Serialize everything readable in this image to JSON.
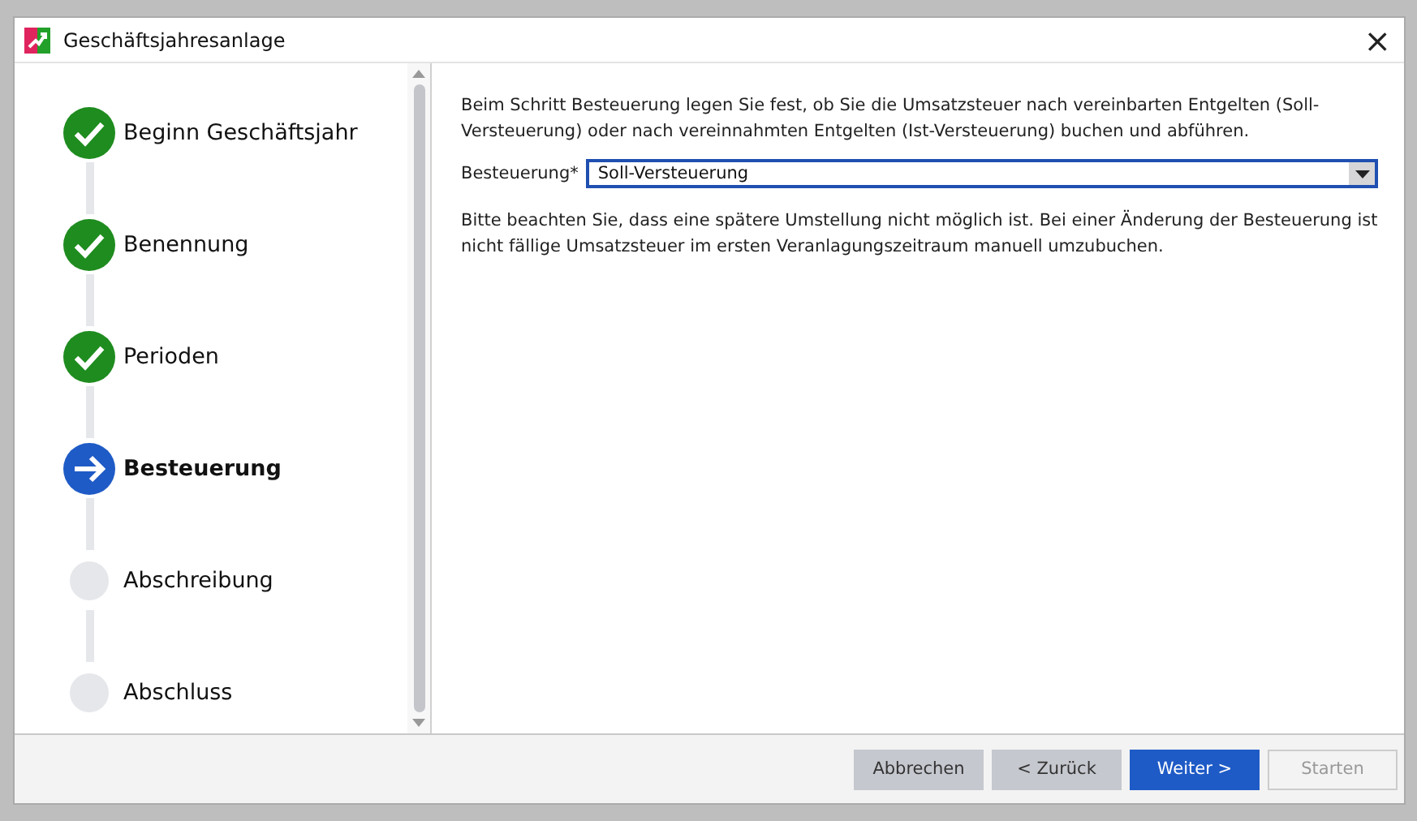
{
  "window": {
    "title": "Geschäftsjahresanlage",
    "close": "×"
  },
  "steps": [
    {
      "label": "Beginn Geschäftsjahr",
      "kind": "done",
      "selected": false
    },
    {
      "label": "Benennung",
      "kind": "done",
      "selected": false
    },
    {
      "label": "Perioden",
      "kind": "done",
      "selected": false
    },
    {
      "label": "Besteuerung",
      "kind": "current",
      "selected": true
    },
    {
      "label": "Abschreibung",
      "kind": "pending",
      "selected": false
    },
    {
      "label": "Abschluss",
      "kind": "pending",
      "selected": false
    }
  ],
  "intro": "Beim Schritt Besteuerung legen Sie fest, ob Sie die Umsatzsteuer nach vereinbarten Entgelten (Soll-Versteuerung) oder nach vereinnahmten Entgelten (Ist-Versteuerung) buchen und abführen.",
  "field": {
    "label": "Besteuerung*",
    "value": "Soll-Versteuerung"
  },
  "note": "Bitte beachten Sie, dass eine spätere Umstellung nicht möglich ist. Bei einer Änderung der Besteuerung ist nicht fällige Umsatzsteuer im ersten Veranlagungszeitraum manuell umzubuchen.",
  "buttons": [
    {
      "label": "Abbrechen",
      "kind": "secondary",
      "disabled": false
    },
    {
      "label": "< Zurück",
      "kind": "secondary",
      "disabled": false
    },
    {
      "label": "Weiter >",
      "kind": "primary",
      "disabled": false
    },
    {
      "label": "Starten",
      "kind": "secondary",
      "disabled": true
    }
  ]
}
